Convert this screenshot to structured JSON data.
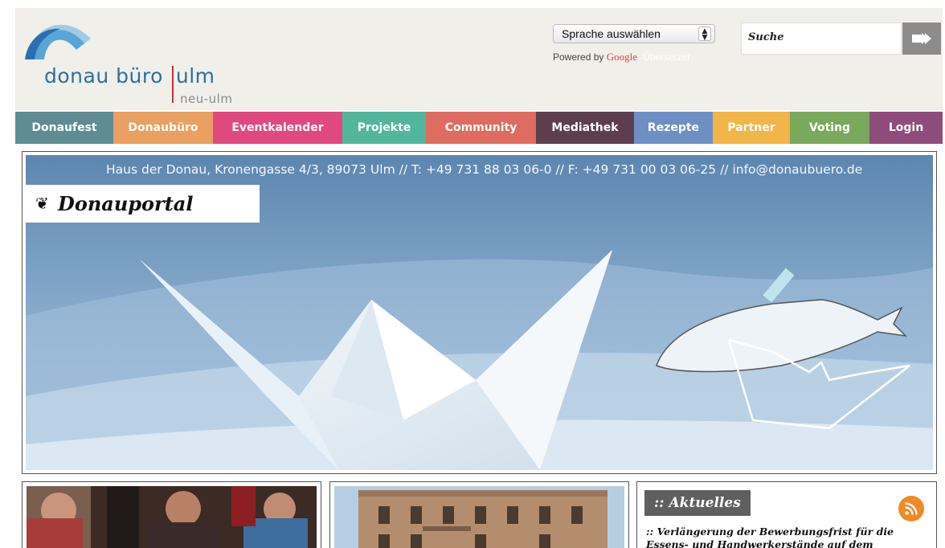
{
  "header": {
    "logo_main": "donau büro",
    "logo_right": "ulm",
    "logo_sub": "neu-ulm",
    "language_select": "Sprache auswählen",
    "powered_by": "Powered by",
    "google": "Google",
    "translate_label": "Übersetzer",
    "search_placeholder": "Suche",
    "search_button_icon": "arrow-right-icon"
  },
  "nav": [
    {
      "label": "Donaufest",
      "color": "#5e8c92"
    },
    {
      "label": "Donaubüro",
      "color": "#e9a061"
    },
    {
      "label": "Eventkalender",
      "color": "#e0497f"
    },
    {
      "label": "Projekte",
      "color": "#51b79c"
    },
    {
      "label": "Community",
      "color": "#de6c60"
    },
    {
      "label": "Mediathek",
      "color": "#5c3e4e"
    },
    {
      "label": "Rezepte",
      "color": "#6e8fc4"
    },
    {
      "label": "Partner",
      "color": "#f2b547"
    },
    {
      "label": "Voting",
      "color": "#7aa85c"
    },
    {
      "label": "Login",
      "color": "#8f4b7c"
    }
  ],
  "hero": {
    "contact": "Haus der Donau, Kronengasse 4/3, 89073 Ulm // T: +49 731 88 03 06-0 // F: +49 731 00 03 06-25 // info@donaubuero.de",
    "portal_icon": "❦",
    "portal_label": "Donauportal"
  },
  "news": {
    "title": ":: Aktuelles",
    "rss_icon": "rss-icon",
    "item": ":: Verlängerung der Bewerbungsfrist für die Essens- und Handwerkerstände auf dem"
  }
}
